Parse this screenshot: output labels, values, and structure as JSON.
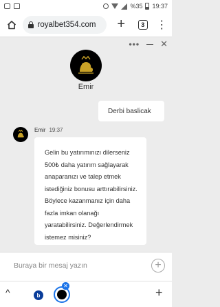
{
  "status_bar": {
    "battery_percent": "%35",
    "time": "19:37",
    "icons": [
      "chat-icon",
      "image-icon",
      "mute-icon",
      "wifi-icon",
      "signal-icon",
      "battery-icon"
    ]
  },
  "browser": {
    "url": "royalbet354.com",
    "tab_count": "3",
    "new_tab": "+",
    "menu": "⋮"
  },
  "chat": {
    "controls": {
      "more": "•••",
      "close": "✕"
    },
    "agent_name": "Emir",
    "messages": {
      "user": {
        "text": "Derbi baslicak"
      },
      "bot": {
        "name": "Emir",
        "time": "19:37",
        "text": "Gelin bu yatırımınızı dilerseniz 500₺ daha yatırım sağlayarak anaparanızı ve talep etmek istediğiniz bonusu arttırabilirsiniz. Böylece kazanmanız için daha fazla imkan olanağı yaratabilirsiniz. Değerlendirmek istemez misiniz?"
      }
    },
    "input": {
      "placeholder": "Buraya bir mesaj yazın"
    },
    "attach": "+"
  },
  "bottom_bar": {
    "chevron": "^",
    "tab_b_label": "b",
    "close_badge": "✕",
    "add": "+"
  },
  "colors": {
    "accent": "#1a73e8",
    "chat_bg": "#ececec",
    "avatar_bg": "#000000",
    "logo_gold": "#c9a227"
  }
}
